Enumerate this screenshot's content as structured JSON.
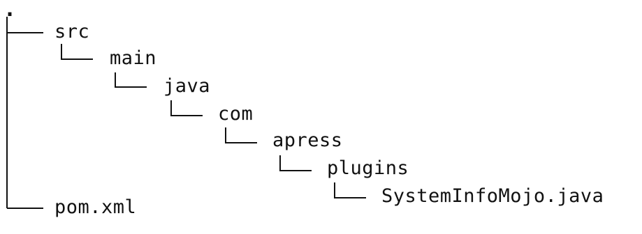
{
  "tree": {
    "root": ".",
    "nodes": [
      {
        "label": "src",
        "depth": 1
      },
      {
        "label": "main",
        "depth": 2
      },
      {
        "label": "java",
        "depth": 3
      },
      {
        "label": "com",
        "depth": 4
      },
      {
        "label": "apress",
        "depth": 5
      },
      {
        "label": "plugins",
        "depth": 6
      },
      {
        "label": "SystemInfoMojo.java",
        "depth": 7
      },
      {
        "label": "pom.xml",
        "depth": 1
      }
    ]
  }
}
